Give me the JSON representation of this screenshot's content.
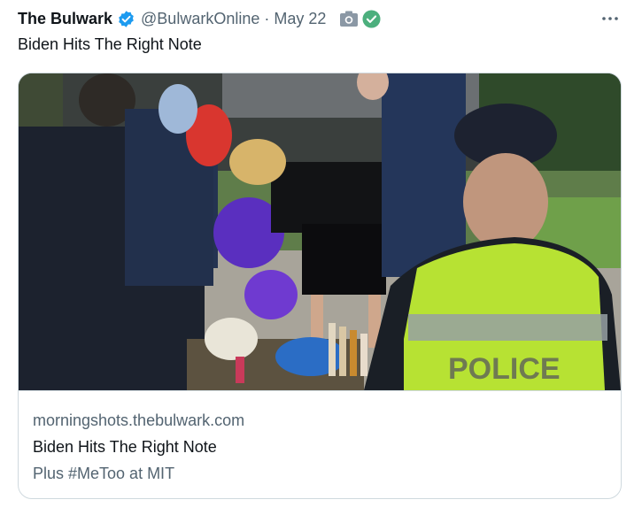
{
  "tweet": {
    "author_name": "The Bulwark",
    "handle": "@BulwarkOnline",
    "separator": "·",
    "date": "May 22",
    "text": "Biden Hits The Right Note"
  },
  "icons": {
    "verified": "verified-badge-icon",
    "camera": "camera-icon",
    "check": "check-circle-icon",
    "more": "more-options-icon"
  },
  "colors": {
    "verified_blue": "#1d9bf0",
    "check_green": "#4caf7d",
    "muted_text": "#536471",
    "border": "#cfd9de"
  },
  "card": {
    "domain": "morningshots.thebulwark.com",
    "title": "Biden Hits The Right Note",
    "description": "Plus #MeToo at MIT",
    "image_text": "POLICE"
  }
}
